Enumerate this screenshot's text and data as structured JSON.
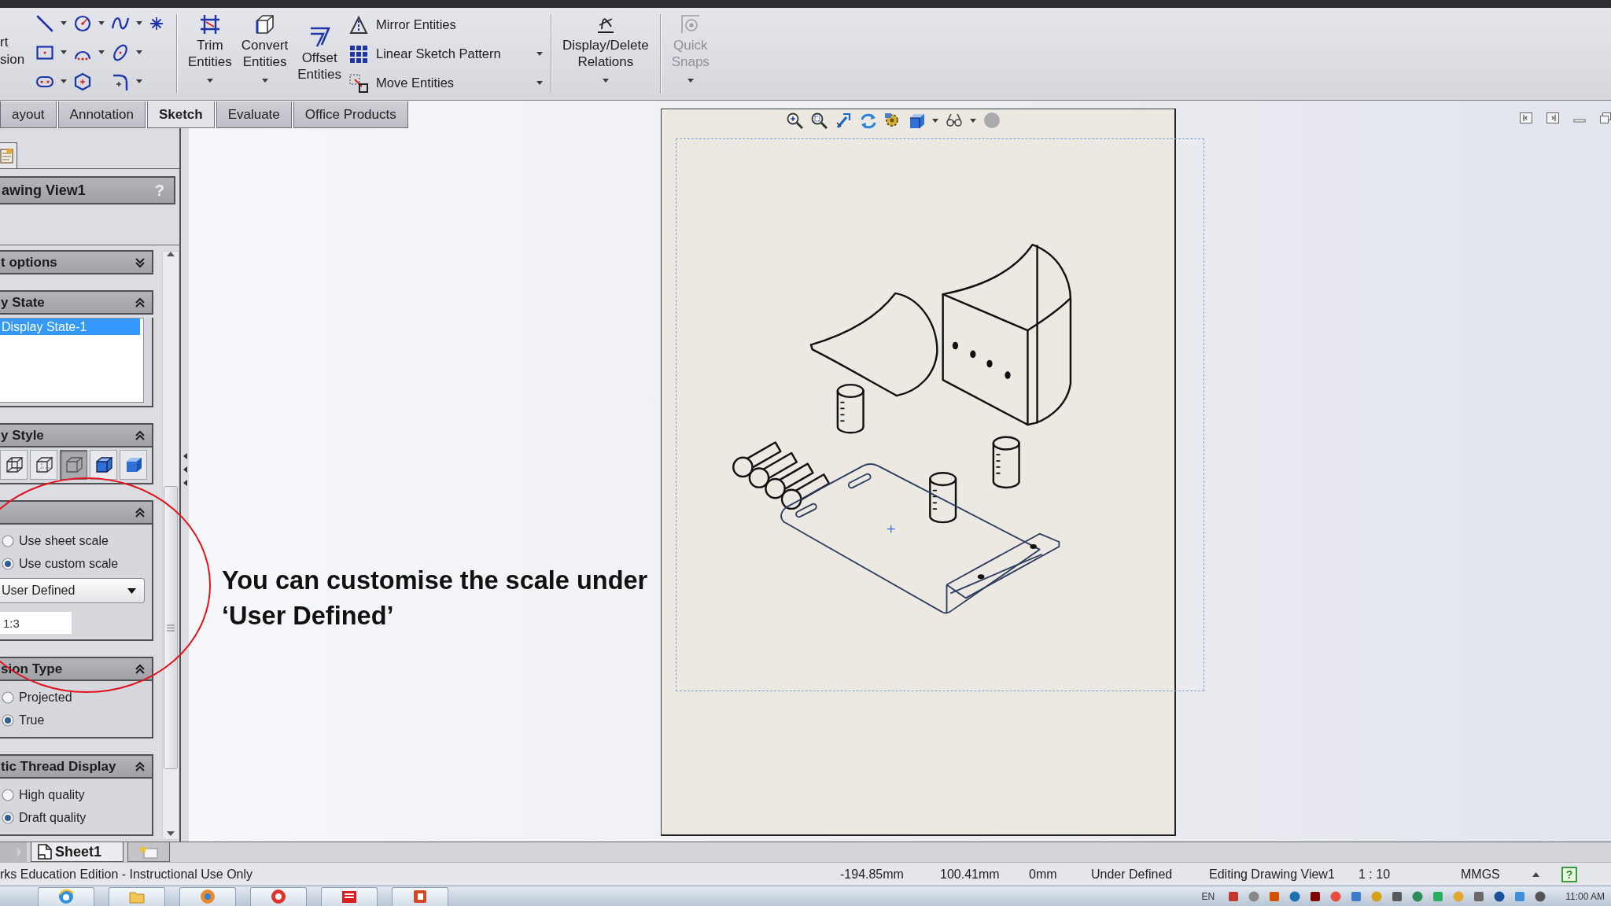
{
  "command_manager": {
    "cut_label": [
      "rt",
      "sion"
    ],
    "edit_buttons": [
      {
        "lines": [
          "Trim",
          "Entities"
        ],
        "dropdown": true
      },
      {
        "lines": [
          "Convert",
          "Entities"
        ],
        "dropdown": true
      },
      {
        "lines": [
          "Offset",
          "Entities"
        ],
        "dropdown": false
      }
    ],
    "edit_commands": [
      {
        "label": "Mirror Entities",
        "dropdown": false
      },
      {
        "label": "Linear Sketch Pattern",
        "dropdown": true
      },
      {
        "label": "Move Entities",
        "dropdown": true
      }
    ],
    "relations_button": {
      "lines": [
        "Display/Delete",
        "Relations"
      ],
      "dropdown": true,
      "disabled": false
    },
    "snaps_button": {
      "lines": [
        "Quick",
        "Snaps"
      ],
      "dropdown": true,
      "disabled": true
    }
  },
  "tabs": [
    {
      "label": "ayout",
      "selected": false
    },
    {
      "label": "Annotation",
      "selected": false
    },
    {
      "label": "Sketch",
      "selected": true
    },
    {
      "label": "Evaluate",
      "selected": false
    },
    {
      "label": "Office Products",
      "selected": false
    }
  ],
  "property_manager": {
    "title": "awing View1",
    "help": "?",
    "sections": [
      {
        "title": "t options",
        "expanded": false
      },
      {
        "kind": "list",
        "title": "y State",
        "expanded": true,
        "items": [
          {
            "label": "Display State-1",
            "selected": true
          }
        ]
      },
      {
        "kind": "style",
        "title": "y Style",
        "expanded": true,
        "buttons": [
          {
            "selected": false
          },
          {
            "selected": false
          },
          {
            "selected": true
          },
          {
            "selected": false
          },
          {
            "selected": false
          }
        ]
      },
      {
        "kind": "scale",
        "expanded": true,
        "options": [
          {
            "label": "Use sheet scale",
            "selected": false
          },
          {
            "label": "Use custom scale",
            "selected": true
          }
        ],
        "scale_menu": "User Defined",
        "custom_scale": "1:3"
      },
      {
        "kind": "radios",
        "title": "sion Type",
        "expanded": true,
        "options": [
          {
            "label": "Projected",
            "selected": false
          },
          {
            "label": "True",
            "selected": true
          }
        ]
      },
      {
        "kind": "radios",
        "title": "tic Thread Display",
        "expanded": true,
        "options": [
          {
            "label": "High quality",
            "selected": false
          },
          {
            "label": "Draft quality",
            "selected": true
          }
        ]
      }
    ]
  },
  "callout": "You can customise the scale under ‘User Defined’",
  "sheet_tabs": [
    {
      "label": "Sheet1",
      "selected": true
    }
  ],
  "status_bar": {
    "edition": "rks Education Edition - Instructional Use Only",
    "readouts": [
      "-194.85mm",
      "100.41mm",
      "0mm",
      "Under Defined",
      "Editing Drawing View1",
      "1 : 10",
      "MMGS"
    ],
    "help": "?"
  },
  "taskbar": {
    "language": "EN",
    "clock": "11:00 AM"
  }
}
